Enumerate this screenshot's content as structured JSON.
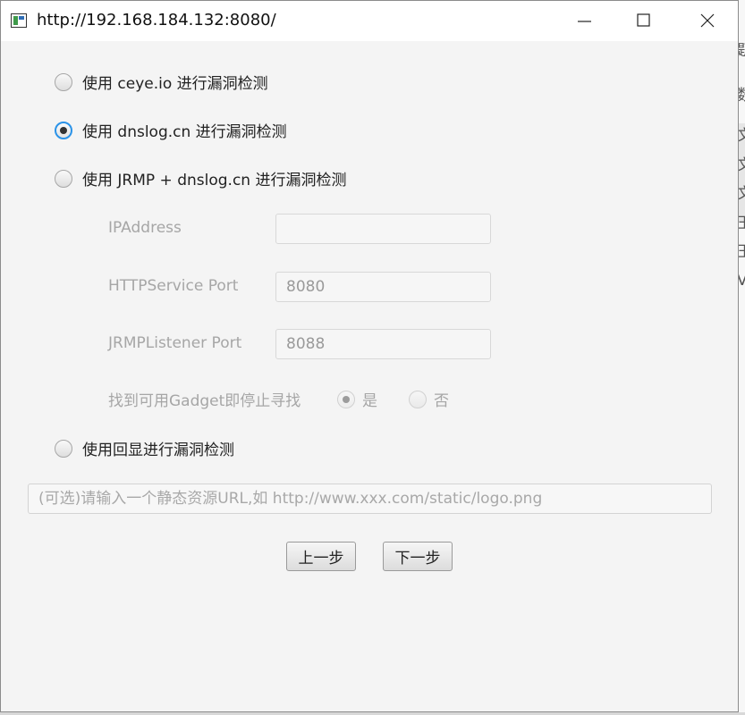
{
  "window": {
    "title": "http://192.168.184.132:8080/",
    "controls": [
      "minimize-icon",
      "maximize-icon",
      "close-icon"
    ]
  },
  "options": [
    {
      "id": "ceye",
      "label": "使用 ceye.io 进行漏洞检测",
      "selected": false
    },
    {
      "id": "dnslog",
      "label": "使用 dnslog.cn 进行漏洞检测",
      "selected": true
    },
    {
      "id": "jrmp",
      "label": "使用 JRMP + dnslog.cn 进行漏洞检测",
      "selected": false
    },
    {
      "id": "echo",
      "label": "使用回显进行漏洞检测",
      "selected": false
    }
  ],
  "jrmp_settings": {
    "ip_label": "IPAddress",
    "ip_value": "",
    "http_port_label": "HTTPService Port",
    "http_port_value": "8080",
    "jrmp_port_label": "JRMPListener Port",
    "jrmp_port_value": "8088",
    "stop_label": "找到可用Gadget即停止寻找",
    "stop_yes": "是",
    "stop_no": "否",
    "stop_selected": "是"
  },
  "static_url": {
    "placeholder": "(可选)请输入一个静态资源URL,如 http://www.xxx.com/static/logo.png",
    "value": ""
  },
  "buttons": {
    "prev": "上一步",
    "next": "下一步"
  },
  "background_window": {
    "glyphs": [
      "题",
      "数",
      "文",
      "文",
      "文",
      "王",
      "王",
      "V"
    ]
  },
  "colors": {
    "selected_ring": "#2b93e8",
    "window_bg": "#f4f4f4",
    "disabled_text": "#a6a6a6"
  }
}
